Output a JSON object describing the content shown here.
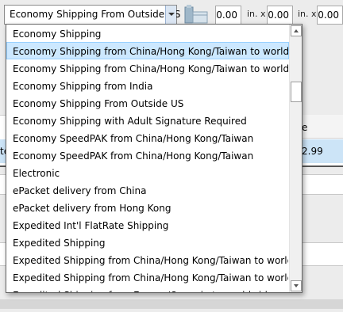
{
  "shipping_combo": {
    "selected_value": "Economy Shipping From Outside US"
  },
  "dimensions": {
    "length": "0.00",
    "width": "0.00",
    "height": "0.00",
    "unit_label": "in. x"
  },
  "background_grid": {
    "header_fragment": "e",
    "row_fragment": "2.99",
    "left_fragment": "te"
  },
  "dropdown": {
    "items": [
      {
        "label": "Economy Shipping"
      },
      {
        "label": "Economy Shipping from China/Hong Kong/Taiwan to worldwide"
      },
      {
        "label": "Economy Shipping from China/Hong Kong/Taiwan to worldwide"
      },
      {
        "label": "Economy Shipping from India"
      },
      {
        "label": "Economy Shipping From Outside US"
      },
      {
        "label": "Economy Shipping with Adult Signature Required"
      },
      {
        "label": "Economy SpeedPAK from China/Hong Kong/Taiwan"
      },
      {
        "label": "Economy SpeedPAK from China/Hong Kong/Taiwan"
      },
      {
        "label": "Electronic"
      },
      {
        "label": "ePacket delivery from China"
      },
      {
        "label": "ePacket delivery from Hong Kong"
      },
      {
        "label": "Expedited Int'l FlatRate Shipping"
      },
      {
        "label": "Expedited Shipping"
      },
      {
        "label": "Expedited Shipping from China/Hong Kong/Taiwan to worldwide"
      },
      {
        "label": "Expedited Shipping from China/Hong Kong/Taiwan to worldwide"
      },
      {
        "label": "Expedited Shipping from Europe/Oceania to worldwide"
      }
    ],
    "highlighted_index": 1
  },
  "colors": {
    "highlight": "#cce8ff",
    "selected_row": "#cce4f7"
  }
}
